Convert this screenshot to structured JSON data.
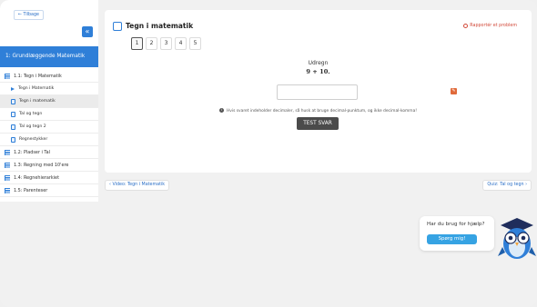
{
  "sidebar": {
    "back_label": "← Tilbage",
    "collapse_label": "«",
    "course_title": "1: Grundlæggende Matematik",
    "items": [
      {
        "label": "1.1: Tegn i Matematik",
        "type": "section"
      },
      {
        "label": "Tegn i Matematik",
        "type": "video"
      },
      {
        "label": "Tegn i matematik",
        "type": "quiz",
        "active": true
      },
      {
        "label": "Tal og tegn",
        "type": "quiz"
      },
      {
        "label": "Tal og tegn 2",
        "type": "quiz"
      },
      {
        "label": "Regnestykker",
        "type": "quiz"
      },
      {
        "label": "1.2: Pladser i Tal",
        "type": "section"
      },
      {
        "label": "1.3: Regning med 10'ere",
        "type": "section"
      },
      {
        "label": "1.4: Regnehierarkiet",
        "type": "section"
      },
      {
        "label": "1.5: Parenteser",
        "type": "section"
      }
    ]
  },
  "main": {
    "title": "Tegn i matematik",
    "report_label": "Rapportér et problem",
    "tabs": [
      "1",
      "2",
      "3",
      "4",
      "5"
    ],
    "active_tab": "1",
    "question_title": "Udregn",
    "question_expression": "9 + 10.",
    "answer_value": "",
    "hint": "Hvis svaret indeholder decimaler, så husk at bruge decimal-punktum, og ikke decimal-komma!",
    "submit_label": "TEST SVAR"
  },
  "nav": {
    "prev_label": "‹  Video: Tegn i Matematik",
    "next_label": "Quiz: Tal og tegn  ›"
  },
  "help": {
    "text": "Har du brug for hjælp?",
    "button_label": "Spørg mig!"
  },
  "colors": {
    "accent": "#2f7fd8",
    "report": "#d24a3a",
    "submit": "#4b4b4b",
    "help_button": "#36a3e3"
  }
}
